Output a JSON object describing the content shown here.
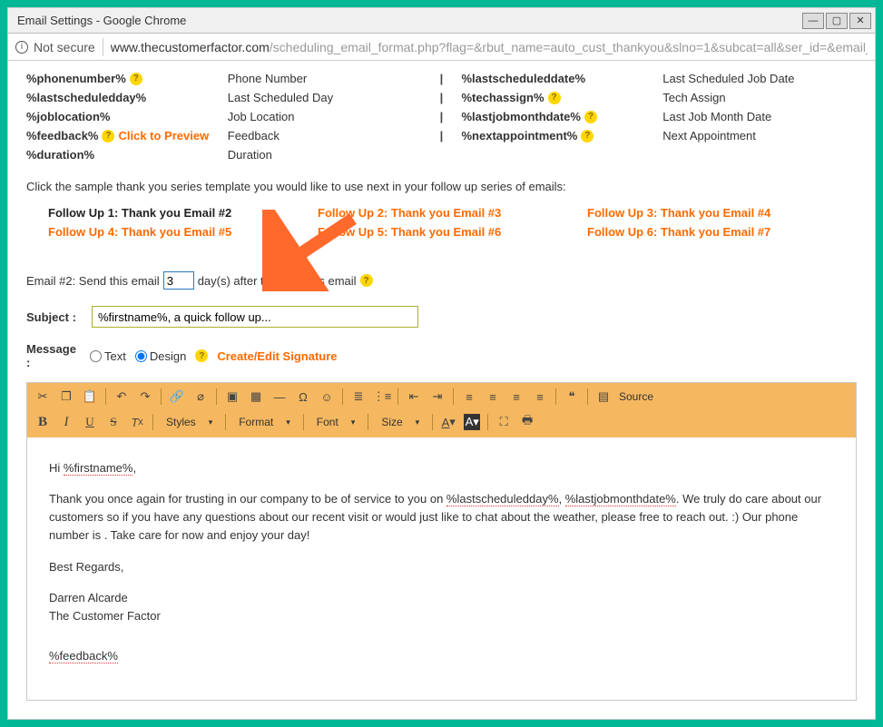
{
  "window": {
    "title": "Email Settings - Google Chrome"
  },
  "addressbar": {
    "security": "Not secure",
    "url_dark": "www.thecustomerfactor.com",
    "url_light": "/scheduling_email_format.php?flag=&rbut_name=auto_cust_thankyou&slno=1&subcat=all&ser_id=&email_..."
  },
  "tokens_left": [
    {
      "tok": "%phonenumber%",
      "q": true,
      "desc": "Phone Number"
    },
    {
      "tok": "%lastscheduledday%",
      "q": false,
      "desc": "Last Scheduled Day"
    },
    {
      "tok": "%joblocation%",
      "q": false,
      "desc": "Job Location"
    },
    {
      "tok": "%feedback%",
      "q": true,
      "desc": "Feedback",
      "preview": "Click to Preview"
    },
    {
      "tok": "%duration%",
      "q": false,
      "desc": "Duration"
    }
  ],
  "tokens_right": [
    {
      "tok": "%lastscheduleddate%",
      "q": false,
      "desc": "Last Scheduled Job Date"
    },
    {
      "tok": "%techassign%",
      "q": true,
      "desc": "Tech Assign"
    },
    {
      "tok": "%lastjobmonthdate%",
      "q": true,
      "desc": "Last Job Month Date"
    },
    {
      "tok": "%nextappointment%",
      "q": true,
      "desc": "Next Appointment"
    }
  ],
  "intro": "Click the sample thank you series template you would like to use next in your follow up series of emails:",
  "followups": [
    {
      "label": "Follow Up 1: Thank you Email #2",
      "active": false
    },
    {
      "label": "Follow Up 2: Thank you Email #3",
      "active": true
    },
    {
      "label": "Follow Up 3: Thank you Email #4",
      "active": true
    },
    {
      "label": "Follow Up 4: Thank you Email #5",
      "active": true
    },
    {
      "label": "Follow Up 5: Thank you Email #6",
      "active": true
    },
    {
      "label": "Follow Up 6: Thank you Email #7",
      "active": true
    }
  ],
  "sendline": {
    "prefix": "Email #2: Send this email",
    "days": "3",
    "suffix": "day(s) after the previous email"
  },
  "subject": {
    "label": "Subject :",
    "value": "%firstname%, a quick follow up..."
  },
  "message": {
    "label": "Message :",
    "opt_text": "Text",
    "opt_design": "Design",
    "signature": "Create/Edit Signature"
  },
  "editor_toolbar": {
    "source": "Source",
    "styles": "Styles",
    "format": "Format",
    "font": "Font",
    "size": "Size"
  },
  "body": {
    "greeting_pre": "Hi ",
    "greeting_tok": "%firstname%",
    "greeting_post": ",",
    "p2a": "Thank you once again for trusting in our company to be of service to you on ",
    "p2b": "%lastscheduledday%",
    "p2c": ", ",
    "p2d": "%lastjobmonthdate%",
    "p2e": ". We truly do care about our customers so if you have any questions about our recent visit or would just like to chat about the weather, please free to reach out. :) Our phone number is . Take care for now and enjoy your day!",
    "regards": "Best Regards,",
    "name": "Darren Alcarde",
    "company": "The Customer Factor",
    "feedback": "%feedback%"
  }
}
